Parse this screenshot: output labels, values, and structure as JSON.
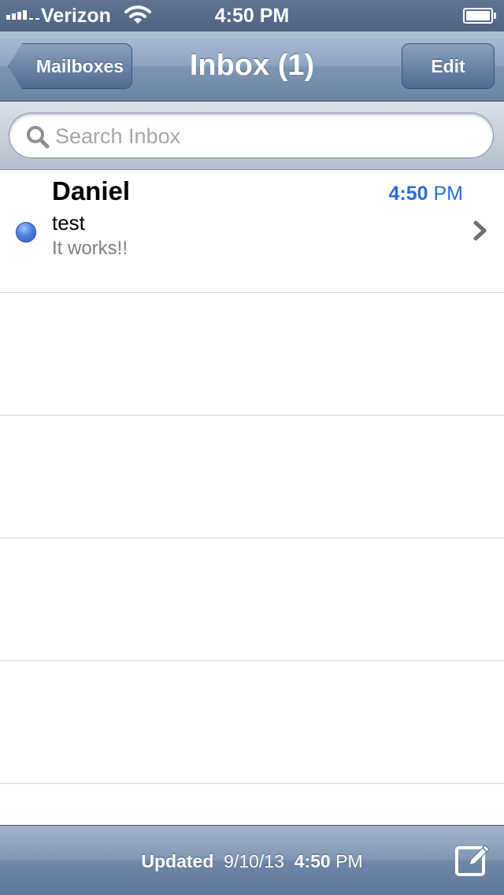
{
  "status_bar": {
    "carrier": "Verizon",
    "time": "4:50 PM"
  },
  "nav": {
    "back_label": "Mailboxes",
    "title": "Inbox (1)",
    "edit_label": "Edit"
  },
  "search": {
    "placeholder": "Search Inbox"
  },
  "messages": [
    {
      "sender": "Daniel",
      "time": "4:50",
      "time_suffix": "PM",
      "subject": "test",
      "preview": "It works!!",
      "unread": true
    }
  ],
  "toolbar": {
    "updated_label": "Updated",
    "updated_date": "9/10/13",
    "updated_time": "4:50",
    "updated_suffix": "PM"
  },
  "colors": {
    "accent": "#2a6dd6",
    "nav": "#7d94b2"
  },
  "icons": [
    "signal-icon",
    "wifi-icon",
    "battery-icon",
    "search-icon",
    "unread-dot-icon",
    "chevron-right-icon",
    "compose-icon"
  ]
}
